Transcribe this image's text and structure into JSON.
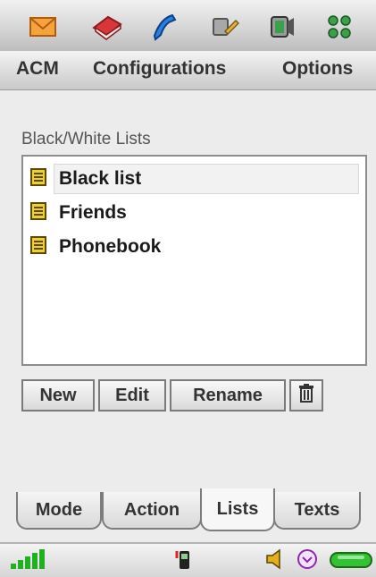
{
  "toolbar": {
    "icons": [
      "envelope-icon",
      "book-icon",
      "phone-handset-icon",
      "settings-tools-icon",
      "media-player-icon",
      "apps-grid-icon"
    ]
  },
  "menu": {
    "items": [
      "ACM",
      "Configurations",
      "Options"
    ]
  },
  "lists_panel": {
    "title": "Black/White Lists",
    "items": [
      "Black list",
      "Friends",
      "Phonebook"
    ],
    "selected_index": 0
  },
  "actions": {
    "new_label": "New",
    "edit_label": "Edit",
    "rename_label": "Rename",
    "delete_icon": "trash-icon"
  },
  "tabs": {
    "items": [
      "Mode",
      "Action",
      "Lists",
      "Texts"
    ],
    "active_index": 2
  },
  "status": {
    "icons": [
      "signal-strength-icon",
      "handset-icon",
      "speaker-icon",
      "clock-icon",
      "battery-icon"
    ]
  },
  "colors": {
    "accent_green": "#22b022",
    "envelope_orange": "#f08a18",
    "book_red": "#c0282a",
    "phone_blue": "#1d6fd0"
  }
}
